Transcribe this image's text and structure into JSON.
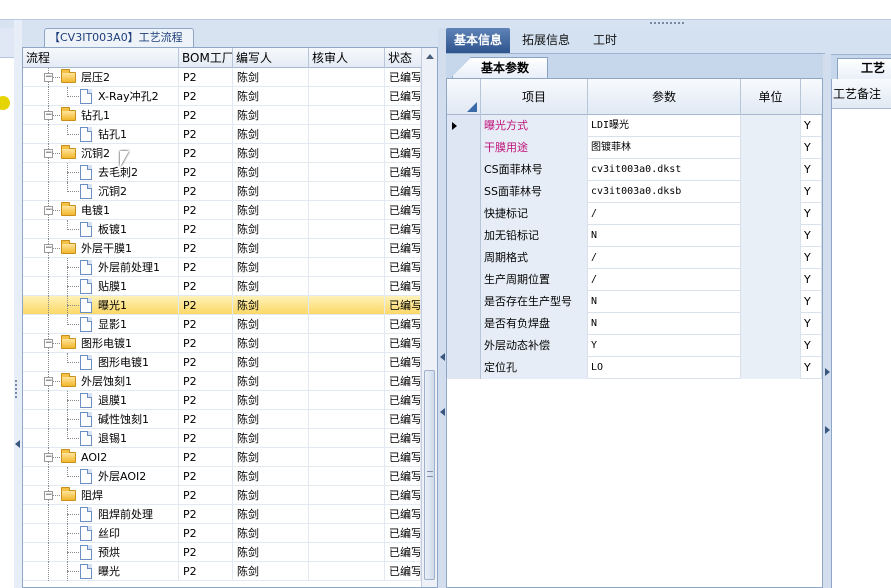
{
  "process_panel": {
    "tab_title": "【CV3IT003A0】工艺流程",
    "columns": [
      "流程",
      "BOM工厂",
      "编写人",
      "核审人",
      "状态"
    ],
    "rows": [
      {
        "level": 1,
        "type": "folder",
        "label": "层压2",
        "bom": "P2",
        "author": "陈剑",
        "reviewer": "",
        "status": "已编写",
        "last": false
      },
      {
        "level": 2,
        "type": "doc",
        "label": "X-Ray冲孔2",
        "bom": "P2",
        "author": "陈剑",
        "reviewer": "",
        "status": "已编写",
        "last": true
      },
      {
        "level": 1,
        "type": "folder",
        "label": "钻孔1",
        "bom": "P2",
        "author": "陈剑",
        "reviewer": "",
        "status": "已编写",
        "last": false
      },
      {
        "level": 2,
        "type": "doc",
        "label": "钻孔1",
        "bom": "P2",
        "author": "陈剑",
        "reviewer": "",
        "status": "已编写",
        "last": true
      },
      {
        "level": 1,
        "type": "folder",
        "label": "沉铜2",
        "bom": "P2",
        "author": "陈剑",
        "reviewer": "",
        "status": "已编写",
        "last": false
      },
      {
        "level": 2,
        "type": "doc",
        "label": "去毛刺2",
        "bom": "P2",
        "author": "陈剑",
        "reviewer": "",
        "status": "已编写",
        "last": false
      },
      {
        "level": 2,
        "type": "doc",
        "label": "沉铜2",
        "bom": "P2",
        "author": "陈剑",
        "reviewer": "",
        "status": "已编写",
        "last": true
      },
      {
        "level": 1,
        "type": "folder",
        "label": "电镀1",
        "bom": "P2",
        "author": "陈剑",
        "reviewer": "",
        "status": "已编写",
        "last": false
      },
      {
        "level": 2,
        "type": "doc",
        "label": "板镀1",
        "bom": "P2",
        "author": "陈剑",
        "reviewer": "",
        "status": "已编写",
        "last": true
      },
      {
        "level": 1,
        "type": "folder",
        "label": "外层干膜1",
        "bom": "P2",
        "author": "陈剑",
        "reviewer": "",
        "status": "已编写",
        "last": false
      },
      {
        "level": 2,
        "type": "doc",
        "label": "外层前处理1",
        "bom": "P2",
        "author": "陈剑",
        "reviewer": "",
        "status": "已编写",
        "last": false
      },
      {
        "level": 2,
        "type": "doc",
        "label": "贴膜1",
        "bom": "P2",
        "author": "陈剑",
        "reviewer": "",
        "status": "已编写",
        "last": false
      },
      {
        "level": 2,
        "type": "doc",
        "label": "曝光1",
        "bom": "P2",
        "author": "陈剑",
        "reviewer": "",
        "status": "已编写",
        "last": false,
        "selected": true
      },
      {
        "level": 2,
        "type": "doc",
        "label": "显影1",
        "bom": "P2",
        "author": "陈剑",
        "reviewer": "",
        "status": "已编写",
        "last": true
      },
      {
        "level": 1,
        "type": "folder",
        "label": "图形电镀1",
        "bom": "P2",
        "author": "陈剑",
        "reviewer": "",
        "status": "已编写",
        "last": false
      },
      {
        "level": 2,
        "type": "doc",
        "label": "图形电镀1",
        "bom": "P2",
        "author": "陈剑",
        "reviewer": "",
        "status": "已编写",
        "last": true
      },
      {
        "level": 1,
        "type": "folder",
        "label": "外层蚀刻1",
        "bom": "P2",
        "author": "陈剑",
        "reviewer": "",
        "status": "已编写",
        "last": false
      },
      {
        "level": 2,
        "type": "doc",
        "label": "退膜1",
        "bom": "P2",
        "author": "陈剑",
        "reviewer": "",
        "status": "已编写",
        "last": false
      },
      {
        "level": 2,
        "type": "doc",
        "label": "碱性蚀刻1",
        "bom": "P2",
        "author": "陈剑",
        "reviewer": "",
        "status": "已编写",
        "last": false
      },
      {
        "level": 2,
        "type": "doc",
        "label": "退锡1",
        "bom": "P2",
        "author": "陈剑",
        "reviewer": "",
        "status": "已编写",
        "last": true
      },
      {
        "level": 1,
        "type": "folder",
        "label": "AOI2",
        "bom": "P2",
        "author": "陈剑",
        "reviewer": "",
        "status": "已编写",
        "last": false
      },
      {
        "level": 2,
        "type": "doc",
        "label": "外层AOI2",
        "bom": "P2",
        "author": "陈剑",
        "reviewer": "",
        "status": "已编写",
        "last": true
      },
      {
        "level": 1,
        "type": "folder",
        "label": "阻焊",
        "bom": "P2",
        "author": "陈剑",
        "reviewer": "",
        "status": "已编写",
        "last": false
      },
      {
        "level": 2,
        "type": "doc",
        "label": "阻焊前处理",
        "bom": "P2",
        "author": "陈剑",
        "reviewer": "",
        "status": "已编写",
        "last": false
      },
      {
        "level": 2,
        "type": "doc",
        "label": "丝印",
        "bom": "P2",
        "author": "陈剑",
        "reviewer": "",
        "status": "已编写",
        "last": false
      },
      {
        "level": 2,
        "type": "doc",
        "label": "预烘",
        "bom": "P2",
        "author": "陈剑",
        "reviewer": "",
        "status": "已编写",
        "last": false
      },
      {
        "level": 2,
        "type": "doc",
        "label": "曝光",
        "bom": "P2",
        "author": "陈剑",
        "reviewer": "",
        "status": "已编写",
        "last": false
      }
    ]
  },
  "main_tabs": [
    "基本信息",
    "拓展信息",
    "工时"
  ],
  "sub_tab": "基本参数",
  "param_grid": {
    "columns": [
      "项目",
      "参数",
      "单位",
      ""
    ],
    "rows": [
      {
        "item": "曝光方式",
        "value": "LDI曝光",
        "unit": "",
        "flag": "Y",
        "pink": true,
        "current": true
      },
      {
        "item": "干膜用途",
        "value": "图镀菲林",
        "unit": "",
        "flag": "Y",
        "pink": true
      },
      {
        "item": "CS面菲林号",
        "value": "cv3it003a0.dkst",
        "unit": "",
        "flag": "Y"
      },
      {
        "item": "SS面菲林号",
        "value": "cv3it003a0.dksb",
        "unit": "",
        "flag": "Y"
      },
      {
        "item": "快捷标记",
        "value": "/",
        "unit": "",
        "flag": "Y"
      },
      {
        "item": "加无铅标记",
        "value": "N",
        "unit": "",
        "flag": "Y"
      },
      {
        "item": "周期格式",
        "value": "/",
        "unit": "",
        "flag": "Y"
      },
      {
        "item": "生产周期位置",
        "value": "/",
        "unit": "",
        "flag": "Y"
      },
      {
        "item": "是否存在生产型号",
        "value": "N",
        "unit": "",
        "flag": "Y"
      },
      {
        "item": "是否有负焊盘",
        "value": "N",
        "unit": "",
        "flag": "Y"
      },
      {
        "item": "外层动态补偿",
        "value": "Y",
        "unit": "",
        "flag": "Y"
      },
      {
        "item": "定位孔",
        "value": "LO",
        "unit": "",
        "flag": "Y"
      }
    ]
  },
  "right_panel": {
    "tab": "工艺",
    "header": "工艺备注"
  },
  "colors": {
    "accent": "#2e548e",
    "selected_row": "#fbd867",
    "pink_text": "#c0127a"
  }
}
